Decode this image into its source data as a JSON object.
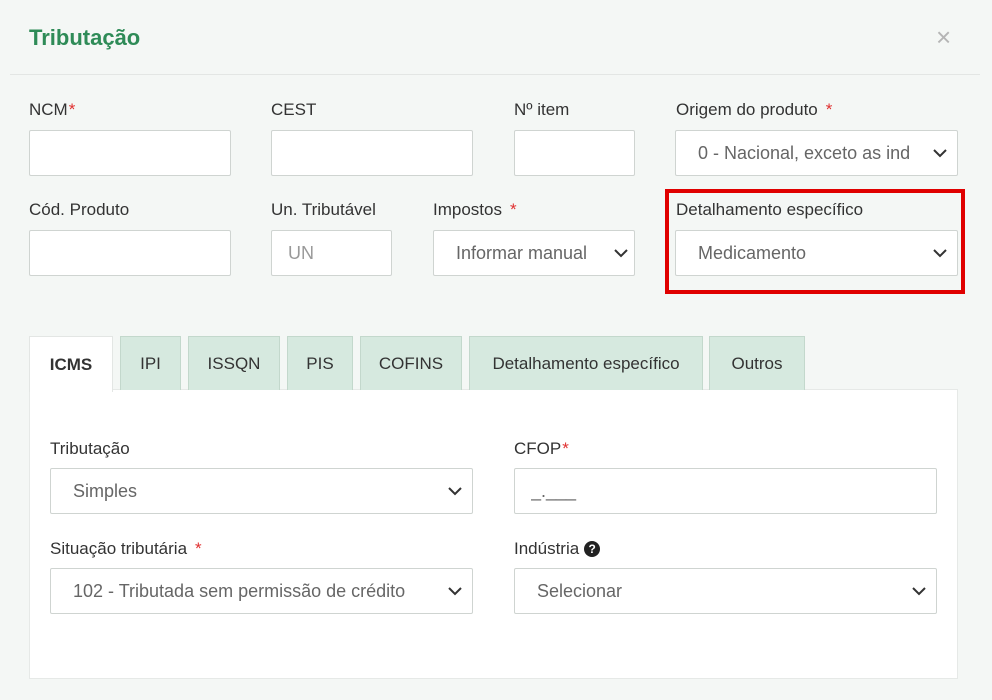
{
  "modal": {
    "title": "Tributação",
    "close": "×"
  },
  "fields": {
    "ncm": {
      "label": "NCM",
      "required": "*",
      "value": ""
    },
    "cest": {
      "label": "CEST",
      "value": ""
    },
    "item_num": {
      "label": "Nº item",
      "value": ""
    },
    "origem": {
      "label": "Origem do produto",
      "required": "*",
      "value": "0 - Nacional, exceto as ind"
    },
    "cod_produto": {
      "label": "Cód. Produto",
      "value": ""
    },
    "un_tributavel": {
      "label": "Un. Tributável",
      "value": "UN"
    },
    "impostos": {
      "label": "Impostos",
      "required": "*",
      "value": "Informar manual"
    },
    "detalhamento": {
      "label": "Detalhamento específico",
      "value": "Medicamento"
    }
  },
  "tabs": [
    {
      "label": "ICMS"
    },
    {
      "label": "IPI"
    },
    {
      "label": "ISSQN"
    },
    {
      "label": "PIS"
    },
    {
      "label": "COFINS"
    },
    {
      "label": "Detalhamento específico"
    },
    {
      "label": "Outros"
    }
  ],
  "icms": {
    "tributacao": {
      "label": "Tributação",
      "value": "Simples"
    },
    "cfop": {
      "label": "CFOP",
      "required": "*",
      "value": "_.___"
    },
    "situacao": {
      "label": "Situação tributária",
      "required": "*",
      "value": "102 - Tributada sem permissão de crédito"
    },
    "industria": {
      "label": "Indústria",
      "help": "?",
      "value": "Selecionar"
    }
  },
  "colors": {
    "title": "#2e8b57",
    "required": "#e03030",
    "tab_inactive": "#d6e9df",
    "highlight": "#e00000"
  }
}
